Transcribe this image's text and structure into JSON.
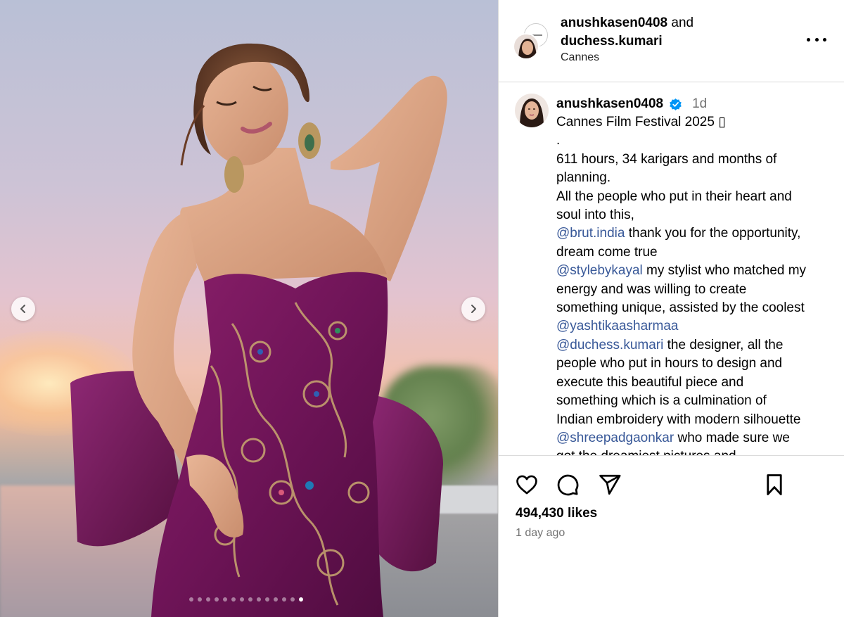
{
  "post": {
    "header": {
      "user1": "anushkasen0408",
      "and_text": "and",
      "user2": "duchess.kumari",
      "location": "Cannes",
      "more_icon": "more-horizontal-icon"
    },
    "caption": {
      "username": "anushkasen0408",
      "verified": true,
      "time": "1d",
      "lines": [
        [
          {
            "t": "Cannes Film Festival 2025 ▯",
            "m": false
          }
        ],
        [
          {
            "t": ".",
            "m": false
          }
        ],
        [
          {
            "t": "611 hours, 34 karigars and months of",
            "m": false
          }
        ],
        [
          {
            "t": "planning.",
            "m": false
          }
        ],
        [
          {
            "t": "All the people who put in their heart and",
            "m": false
          }
        ],
        [
          {
            "t": "soul into this,",
            "m": false
          }
        ],
        [
          {
            "t": "@brut.india",
            "m": true
          },
          {
            "t": " thank you for the opportunity,",
            "m": false
          }
        ],
        [
          {
            "t": "dream come true",
            "m": false
          }
        ],
        [
          {
            "t": "@stylebykayal",
            "m": true
          },
          {
            "t": " my stylist who matched my",
            "m": false
          }
        ],
        [
          {
            "t": "energy and was willing to create",
            "m": false
          }
        ],
        [
          {
            "t": "something unique, assisted by the coolest",
            "m": false
          }
        ],
        [
          {
            "t": "@yashtikaasharmaa",
            "m": true
          }
        ],
        [
          {
            "t": "@duchess.kumari",
            "m": true
          },
          {
            "t": " the designer, all the",
            "m": false
          }
        ],
        [
          {
            "t": "people who put in hours to design and",
            "m": false
          }
        ],
        [
          {
            "t": "execute this beautiful piece and",
            "m": false
          }
        ],
        [
          {
            "t": "something which is a culmination of",
            "m": false
          }
        ],
        [
          {
            "t": "Indian embroidery with modern silhouette",
            "m": false
          }
        ],
        [
          {
            "t": "@shreepadgaonkar",
            "m": true
          },
          {
            "t": " who made sure we",
            "m": false
          }
        ],
        [
          {
            "t": "got the dreamiest pictures and",
            "m": false
          }
        ]
      ]
    },
    "stats": {
      "likes": "494,430 likes",
      "posted": "1 day ago"
    },
    "actions": [
      "like-icon",
      "comment-icon",
      "share-icon",
      "save-icon"
    ],
    "carousel": {
      "slide_count": 14,
      "active_index": 13
    },
    "colors": {
      "mention": "#385898",
      "verified": "#0095f6",
      "secondary_text": "#737373",
      "divider": "#dbdbdb"
    }
  }
}
